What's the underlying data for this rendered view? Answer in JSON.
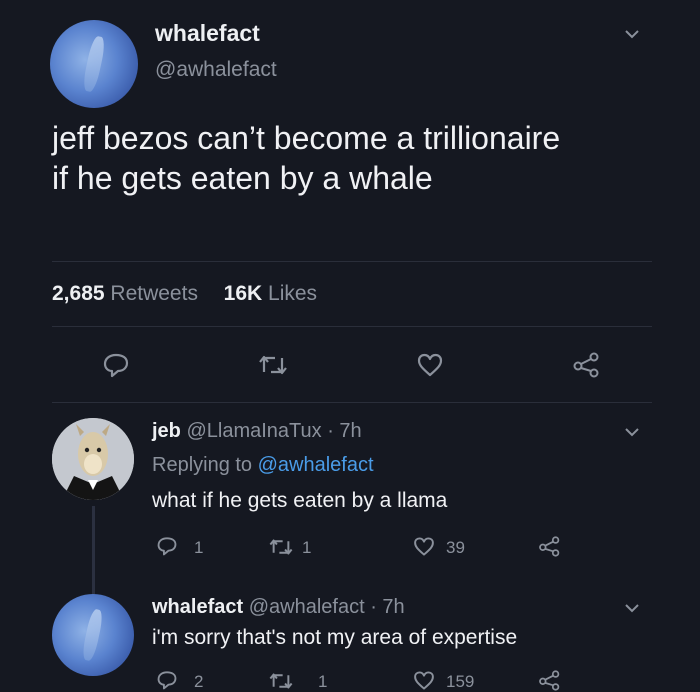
{
  "main_tweet": {
    "display_name": "whalefact",
    "handle": "@awhalefact",
    "text_line1": "jeff bezos can’t become a trillionaire",
    "text_line2": "if he gets eaten by a whale",
    "retweets_count": "2,685",
    "retweets_label": "Retweets",
    "likes_count": "16K",
    "likes_label": "Likes"
  },
  "replies": [
    {
      "display_name": "jeb",
      "handle": "@LlamaInaTux",
      "time": "· 7h",
      "replying_prefix": "Replying to",
      "replying_to": "@awhalefact",
      "text": "what if he gets eaten by a llama",
      "reply_count": "1",
      "retweet_count": "1",
      "like_count": "39"
    },
    {
      "display_name": "whalefact",
      "handle": "@awhalefact",
      "time": "· 7h",
      "text": "i'm sorry that's not my area of expertise",
      "reply_count": "2",
      "retweet_count": "1",
      "like_count": "159"
    }
  ],
  "icons": {
    "reply": "reply-icon",
    "retweet": "retweet-icon",
    "like": "heart-icon",
    "share": "share-icon",
    "menu": "chevron-down-icon"
  },
  "colors": {
    "background": "#151821",
    "link": "#4a9ce8",
    "muted": "#8b919c"
  }
}
